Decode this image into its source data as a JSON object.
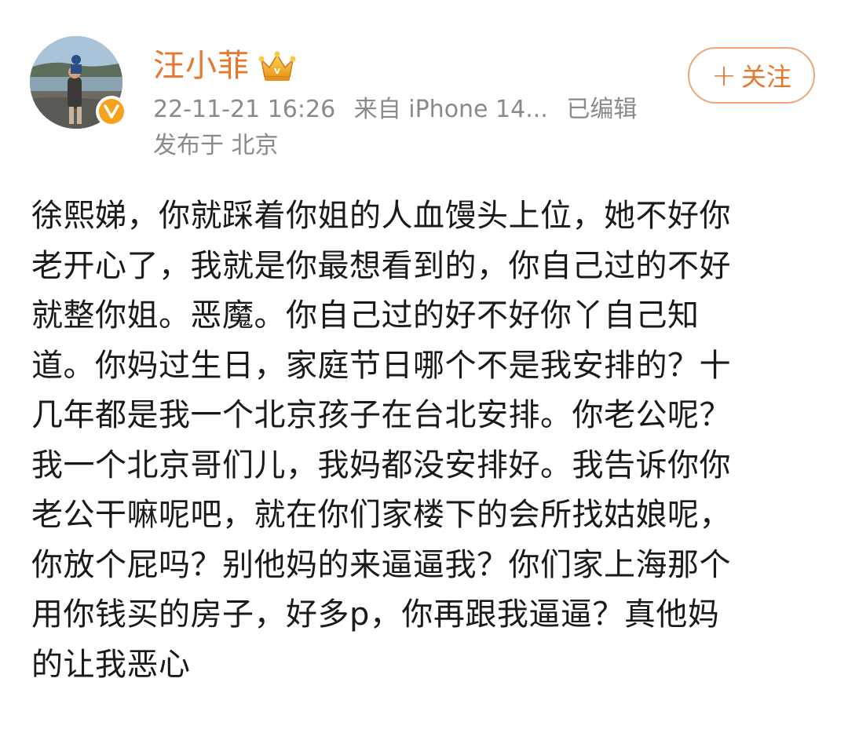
{
  "author": {
    "name": "汪小菲",
    "avatar_icon": "user-avatar-photo",
    "verified_icon": "verified-v-badge",
    "member_icon": "crown-icon"
  },
  "meta": {
    "timestamp": "22-11-21 16:26",
    "source": "来自 iPhone 14...",
    "edited": "已编辑",
    "location": "发布于 北京"
  },
  "follow_button": {
    "plus": "+",
    "label": "关注"
  },
  "post": {
    "lines": [
      "徐熙娣，你就踩着你姐的人血馒头上位，她不好你",
      "老开心了，我就是你最想看到的，你自己过的不好",
      "就整你姐。恶魔。你自己过的好不好你丫自己知",
      "道。你妈过生日，家庭节日哪个不是我安排的？十",
      "几年都是我一个北京孩子在台北安排。你老公呢？",
      "我一个北京哥们儿，我妈都没安排好。我告诉你你",
      "老公干嘛呢吧，就在你们家楼下的会所找姑娘呢，",
      "你放个屁吗？别他妈的来逼逼我？你们家上海那个",
      "用你钱买的房子，好多p，你再跟我逼逼？真他妈",
      "的让我恶心"
    ]
  },
  "colors": {
    "accent": "#e8772e",
    "meta_gray": "#8a8a8a",
    "badge": "#f7a21b"
  }
}
